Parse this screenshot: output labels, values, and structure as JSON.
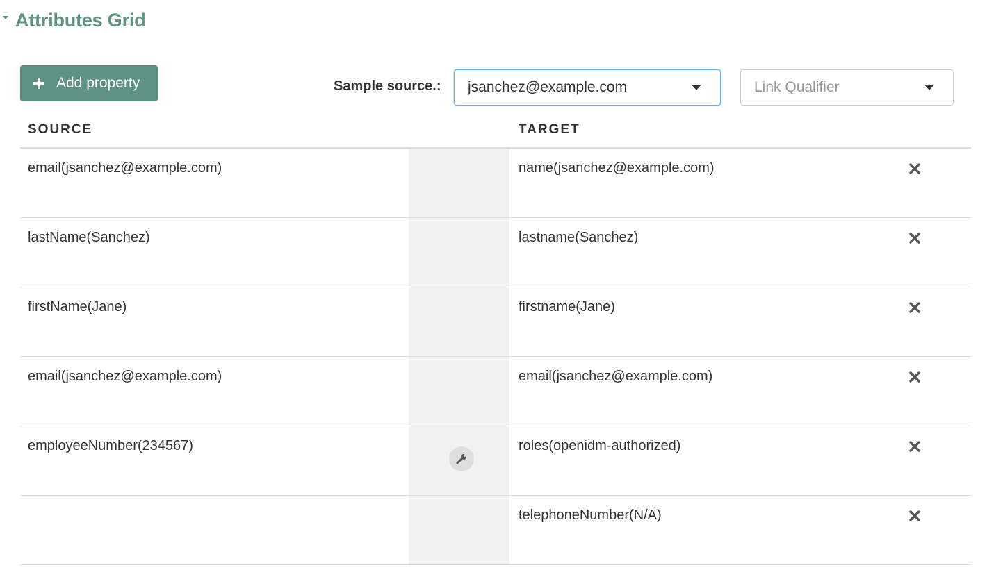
{
  "section": {
    "title": "Attributes Grid"
  },
  "toolbar": {
    "add_property_label": "Add property",
    "sample_source_label": "Sample source.:",
    "sample_source_value": "jsanchez@example.com",
    "link_qualifier_placeholder": "Link Qualifier"
  },
  "grid": {
    "headers": {
      "source": "SOURCE",
      "target": "TARGET"
    },
    "rows": [
      {
        "source": "email(jsanchez@example.com)",
        "target": "name(jsanchez@example.com)",
        "has_transform": false
      },
      {
        "source": "lastName(Sanchez)",
        "target": "lastname(Sanchez)",
        "has_transform": false
      },
      {
        "source": "firstName(Jane)",
        "target": "firstname(Jane)",
        "has_transform": false
      },
      {
        "source": "email(jsanchez@example.com)",
        "target": "email(jsanchez@example.com)",
        "has_transform": false
      },
      {
        "source": "employeeNumber(234567)",
        "target": "roles(openidm-authorized)",
        "has_transform": true,
        "transform_icon": "wrench-icon"
      },
      {
        "source": "",
        "target": "telephoneNumber(N/A)",
        "has_transform": false
      }
    ]
  },
  "icons": {
    "collapse": "caret-down-icon",
    "add": "plus-icon",
    "dropdown": "chevron-down-icon",
    "remove": "close-icon",
    "transform": "wrench-icon"
  },
  "colors": {
    "accent": "#5e9384",
    "focus_border": "#66afe9",
    "mid_band": "#f2f2f2",
    "divider": "#dddddd"
  }
}
